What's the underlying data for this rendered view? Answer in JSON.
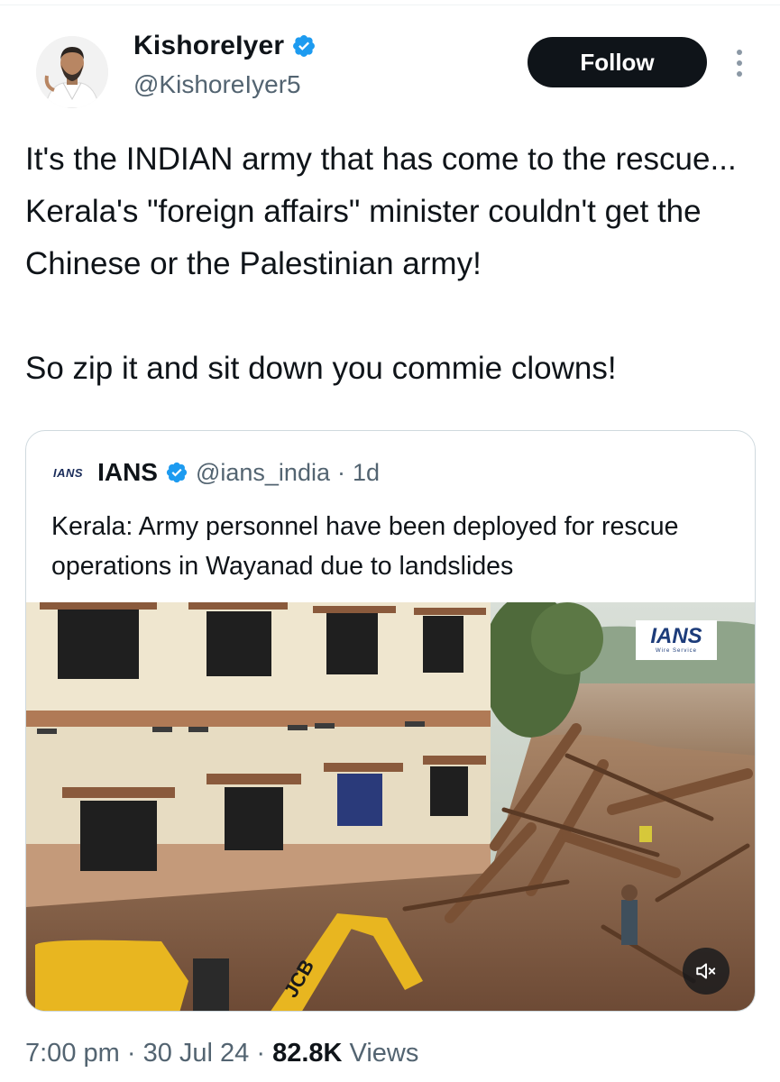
{
  "author": {
    "display_name": "KishoreIyer",
    "handle": "@KishoreIyer5",
    "verified": true,
    "avatar_icon": "person-avatar"
  },
  "actions": {
    "follow_label": "Follow",
    "more_icon": "more-vertical-icon"
  },
  "tweet": {
    "paragraphs": [
      "It's the INDIAN army that has come to the rescue... Kerala's \"foreign affairs\" minister couldn't get the Chinese or the Palestinian army!",
      "So zip it and sit down you commie clowns!"
    ]
  },
  "quoted": {
    "logo_text": "IANS",
    "name": "IANS",
    "handle": "@ians_india",
    "separator": "·",
    "age": "1d",
    "text": "Kerala: Army personnel have been deployed for rescue operations in Wayanad due to landslides",
    "media": {
      "watermark": "IANS",
      "watermark_sub": "Wire Service",
      "mute_icon": "speaker-muted-icon"
    }
  },
  "meta": {
    "time": "7:00 pm",
    "dot": "·",
    "date": "30 Jul 24",
    "views_count": "82.8K",
    "views_label": "Views"
  },
  "colors": {
    "text_primary": "#0f1419",
    "text_secondary": "#536471",
    "verified_blue": "#1d9bf0",
    "border": "#cfd9de",
    "follow_bg": "#0f1419"
  }
}
